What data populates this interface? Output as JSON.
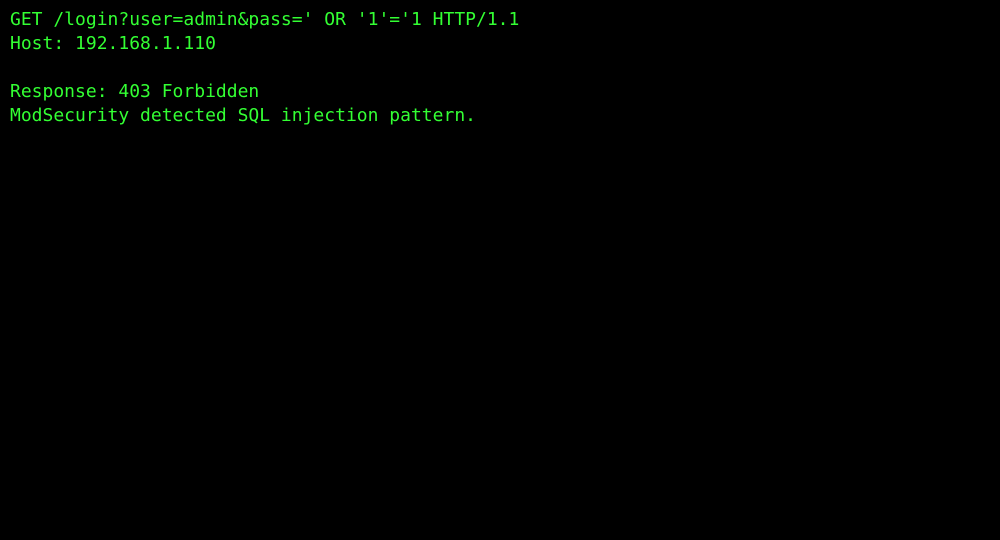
{
  "colors": {
    "background": "#000000",
    "foreground": "#33ff33"
  },
  "terminal": {
    "request_line": "GET /login?user=admin&pass=' OR '1'='1 HTTP/1.1",
    "host_line": "Host: 192.168.1.110",
    "response_line": "Response: 403 Forbidden",
    "message_line": "ModSecurity detected SQL injection pattern."
  }
}
